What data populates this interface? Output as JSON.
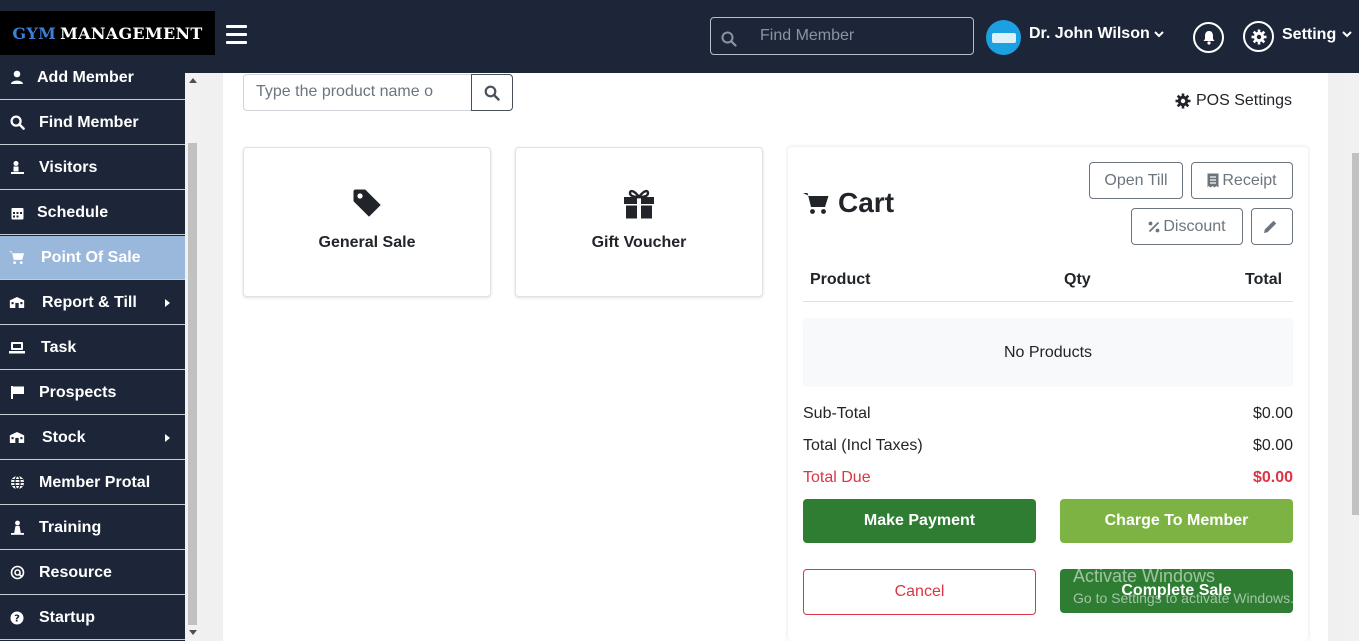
{
  "header": {
    "logo_part1": "GYM",
    "logo_part2": "MANAGEMENT",
    "search_placeholder": "Find Member",
    "username": "Dr. John Wilson",
    "setting_label": "Setting"
  },
  "sidebar": {
    "items": [
      {
        "label": "Add Member",
        "icon": "user-icon"
      },
      {
        "label": "Find Member",
        "icon": "search-icon"
      },
      {
        "label": "Visitors",
        "icon": "visitor-icon"
      },
      {
        "label": "Schedule",
        "icon": "calendar-icon"
      },
      {
        "label": "Point Of Sale",
        "icon": "cart-icon",
        "active": true
      },
      {
        "label": "Report & Till",
        "icon": "report-icon",
        "has_submenu": true
      },
      {
        "label": "Task",
        "icon": "task-icon"
      },
      {
        "label": "Prospects",
        "icon": "flag-icon"
      },
      {
        "label": "Stock",
        "icon": "stock-icon",
        "has_submenu": true
      },
      {
        "label": "Member Protal",
        "icon": "globe-icon"
      },
      {
        "label": "Training",
        "icon": "training-icon"
      },
      {
        "label": "Resource",
        "icon": "resource-icon"
      },
      {
        "label": "Startup",
        "icon": "help-icon"
      }
    ]
  },
  "pos": {
    "product_search_placeholder": "Type the product name o",
    "pos_settings_label": "POS Settings",
    "tiles": [
      {
        "label": "General Sale",
        "icon": "tag-icon"
      },
      {
        "label": "Gift Voucher",
        "icon": "gift-icon"
      }
    ]
  },
  "cart": {
    "title": "Cart",
    "open_till": "Open Till",
    "receipt": "Receipt",
    "discount": "Discount",
    "col_product": "Product",
    "col_qty": "Qty",
    "col_total": "Total",
    "empty_text": "No Products",
    "subtotal_label": "Sub-Total",
    "subtotal_value": "$0.00",
    "total_label": "Total (Incl Taxes)",
    "total_value": "$0.00",
    "due_label": "Total Due",
    "due_value": "$0.00",
    "make_payment": "Make Payment",
    "charge_member": "Charge To Member",
    "cancel": "Cancel",
    "complete_sale": "Complete Sale"
  },
  "watermark": {
    "line1": "Activate Windows",
    "line2": "Go to Settings to activate Windows."
  },
  "colors": {
    "topbar": "#1d2638",
    "active_item": "#9ab8dc",
    "pay_green": "#2e7d32",
    "charge_green": "#7cb342",
    "danger": "#dc3545"
  }
}
